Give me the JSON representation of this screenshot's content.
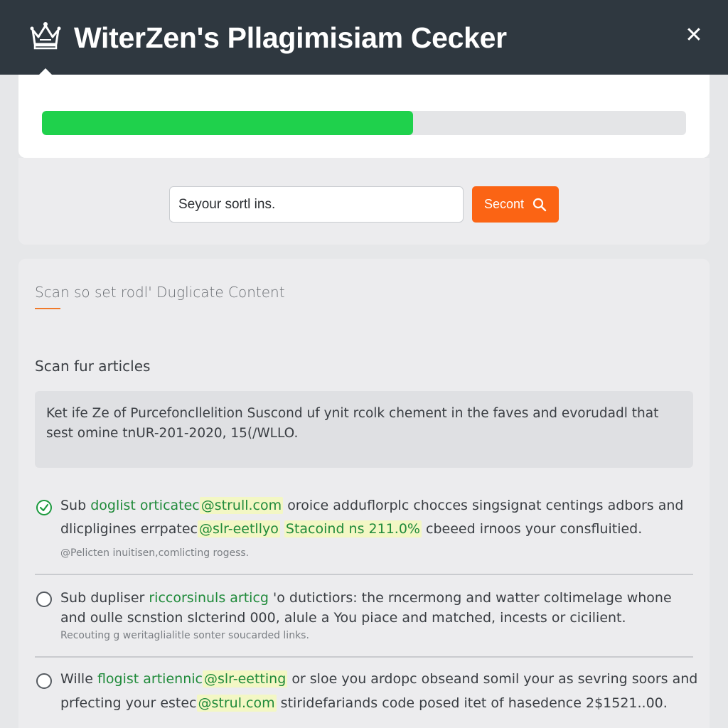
{
  "window": {
    "title": "WiterZen's Pllagimisiam Cecker",
    "close_icon": "close-icon",
    "logo_icon": "crown-icon"
  },
  "progress": {
    "value": 0.576,
    "fill_color": "#1fd14c",
    "track_color": "#e4e5e7"
  },
  "search": {
    "input_value": "Seyour sortl ins.",
    "button_label": "Secont",
    "button_icon": "search-icon",
    "button_color": "#fb6414"
  },
  "results_panel": {
    "section_title": "Scan so set rodl' Duglicate Content",
    "scan_label": "Scan fur articles",
    "excerpt_line1": "Ket ife Ze of Purcefoncllelition Suscond uf ynit rcolk chement in the faves and evorudadl that",
    "excerpt_line2": "sest omine tnUR-201-2020, 15(/WLLO.",
    "results": [
      {
        "checked": true,
        "l1_a": "Sub",
        "l1_b": "doglist orticatec",
        "l1_c": "@strull.com",
        "l1_d": "oroice adduflorplc chocces singsignat centings adbors and",
        "l2_a": "dlicpligines errpatec",
        "l2_b": "@slr-eetllyo",
        "l2_c": "Stacoind ns 211.0%",
        "l2_d": "cbeeed irnoos your consfluitied.",
        "note": "@Pelicten inuitisen,comlicting rogess."
      },
      {
        "checked": false,
        "l1_a": "Sub dupliser",
        "l1_b": "riccorsinuls articg",
        "l1_c": "'o dutictiors: the rncermong and watter coltimelage whone",
        "l2_a": "and oulle scnstion slcterind 000, alule a You piace and matched, incests or cicilient.",
        "note": "Recouting g weritaglialitle sonter soucarded links."
      },
      {
        "checked": false,
        "l1_a": "Wille",
        "l1_b": "flogist artiennic",
        "l1_c": "@slr-eetting",
        "l1_d": "or sloe you ardopc obseand somil your as sevring soors and",
        "l2_a": "prfecting your estec",
        "l2_b": "@strul.com",
        "l2_c": "stiridefariands code posed itet of hasedence 2$1521..00."
      }
    ]
  }
}
